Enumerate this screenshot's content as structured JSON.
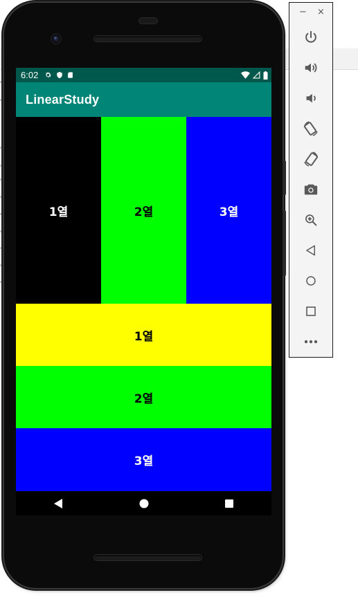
{
  "colors": {
    "status_bar": "#00574b",
    "app_bar": "#008577",
    "black": "#000000",
    "green": "#00ff00",
    "blue": "#0000ff",
    "yellow": "#ffff00",
    "toolbar_icon": "#5a5a5a"
  },
  "status_bar": {
    "time": "6:02",
    "icons_left": [
      "settings-gear-icon",
      "shield-icon",
      "sd-card-icon"
    ],
    "icons_right": [
      "wifi-icon",
      "cellular-signal-icon",
      "battery-icon"
    ]
  },
  "app_bar": {
    "title": "LinearStudy"
  },
  "columns": [
    {
      "label": "1열",
      "bg": "#000000",
      "fg": "#ffffff"
    },
    {
      "label": "2열",
      "bg": "#00ff00",
      "fg": "#000000"
    },
    {
      "label": "3열",
      "bg": "#0000ff",
      "fg": "#ffffff"
    }
  ],
  "rows": [
    {
      "label": "1열",
      "bg": "#ffff00",
      "fg": "#000000"
    },
    {
      "label": "2열",
      "bg": "#00ff00",
      "fg": "#000000"
    },
    {
      "label": "3열",
      "bg": "#0000ff",
      "fg": "#ffffff"
    }
  ],
  "nav_bar": [
    "back-triangle-icon",
    "home-circle-icon",
    "recents-square-icon"
  ],
  "toolbar": {
    "minimize": "−",
    "close": "×",
    "buttons": [
      "power-icon",
      "volume-up-icon",
      "volume-down-icon",
      "rotate-left-icon",
      "rotate-right-icon",
      "camera-icon",
      "zoom-icon",
      "back-icon",
      "home-icon",
      "overview-icon",
      "more-icon"
    ]
  }
}
